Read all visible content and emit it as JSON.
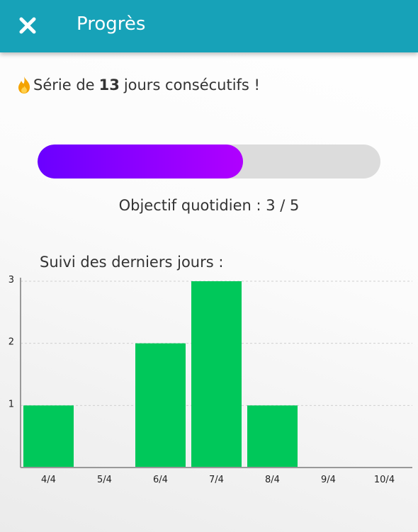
{
  "header": {
    "title": "Progrès",
    "close_icon": "close-icon",
    "background": "#17a2b8"
  },
  "streak": {
    "icon": "flame-icon",
    "prefix": "Série de",
    "count": "13",
    "suffix": "jours consécutifs !"
  },
  "goal": {
    "label": "Objectif quotidien : 3 / 5",
    "done": 3,
    "target": 5,
    "fill_gradient": [
      "#6a00ff",
      "#b000ff"
    ]
  },
  "history": {
    "title": "Suivi des derniers jours :"
  },
  "chart_data": {
    "type": "bar",
    "categories": [
      "4/4",
      "5/4",
      "6/4",
      "7/4",
      "8/4",
      "9/4",
      "10/4"
    ],
    "values": [
      1,
      0,
      2,
      3,
      1,
      0,
      0
    ],
    "yticks": [
      "1",
      "2",
      "3"
    ],
    "ylim": [
      0,
      3
    ],
    "grid": "horizontal-dashed",
    "bar_color": "#00c85a"
  }
}
